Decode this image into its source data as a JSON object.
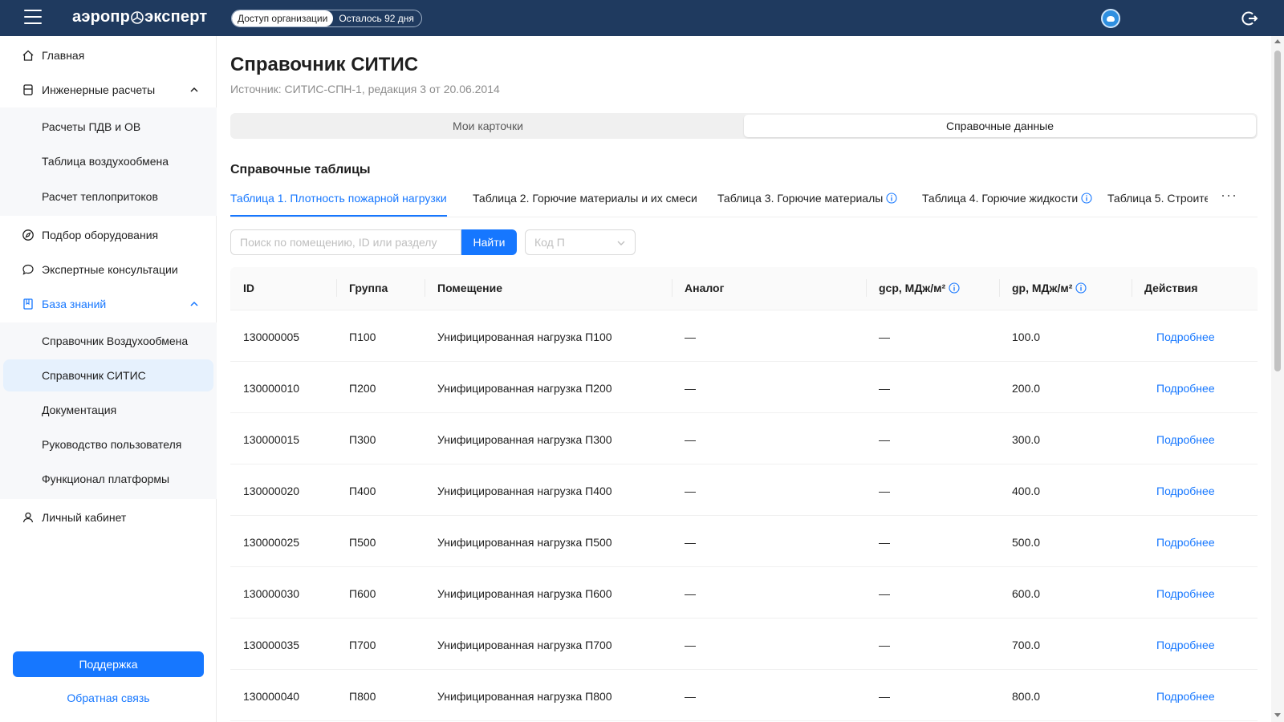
{
  "header": {
    "logo_left": "аэропр",
    "logo_right": "эксперт",
    "access_label": "Доступ организации",
    "remaining_label": "Осталось 92 дня",
    "colors": {
      "bar": "#1f3a5f",
      "accent": "#1677ff"
    }
  },
  "sidebar": {
    "home": "Главная",
    "engineering": "Инженерные расчеты",
    "engineering_items": [
      "Расчеты ПДВ и ОВ",
      "Таблица воздухообмена",
      "Расчет теплопритоков"
    ],
    "equipment": "Подбор оборудования",
    "expert": "Экспертные консультации",
    "knowledge": "База знаний",
    "knowledge_items": [
      "Справочник Воздухообмена",
      "Справочник СИТИС",
      "Документация",
      "Руководство пользователя",
      "Функционал платформы"
    ],
    "account": "Личный кабинет",
    "support": "Поддержка",
    "feedback": "Обратная связь"
  },
  "main": {
    "title": "Справочник СИТИС",
    "source": "Источник: СИТИС-СПН-1, редакция 3 от 20.06.2014",
    "segments": [
      "Мои карточки",
      "Справочные данные"
    ],
    "section_title": "Справочные таблицы",
    "tabs": [
      "Таблица 1. Плотность пожарной нагрузки",
      "Таблица 2. Горючие материалы и их смеси",
      "Таблица 3. Горючие материалы",
      "Таблица 4. Горючие жидкости",
      "Таблица 5. Строите"
    ],
    "tab_more": "···",
    "search_placeholder": "Поиск по помещению, ID или разделу",
    "search_button": "Найти",
    "select_placeholder": "Код П"
  },
  "table": {
    "columns": [
      "ID",
      "Группа",
      "Помещение",
      "Аналог",
      "gср, МДж/м²",
      "gр, МДж/м²",
      "Действия"
    ],
    "rows": [
      [
        "130000005",
        "П100",
        "Унифицированная нагрузка П100",
        "—",
        "—",
        "100.0",
        "Подробнее"
      ],
      [
        "130000010",
        "П200",
        "Унифицированная нагрузка П200",
        "—",
        "—",
        "200.0",
        "Подробнее"
      ],
      [
        "130000015",
        "П300",
        "Унифицированная нагрузка П300",
        "—",
        "—",
        "300.0",
        "Подробнее"
      ],
      [
        "130000020",
        "П400",
        "Унифицированная нагрузка П400",
        "—",
        "—",
        "400.0",
        "Подробнее"
      ],
      [
        "130000025",
        "П500",
        "Унифицированная нагрузка П500",
        "—",
        "—",
        "500.0",
        "Подробнее"
      ],
      [
        "130000030",
        "П600",
        "Унифицированная нагрузка П600",
        "—",
        "—",
        "600.0",
        "Подробнее"
      ],
      [
        "130000035",
        "П700",
        "Унифицированная нагрузка П700",
        "—",
        "—",
        "700.0",
        "Подробнее"
      ],
      [
        "130000040",
        "П800",
        "Унифицированная нагрузка П800",
        "—",
        "—",
        "800.0",
        "Подробнее"
      ]
    ]
  }
}
